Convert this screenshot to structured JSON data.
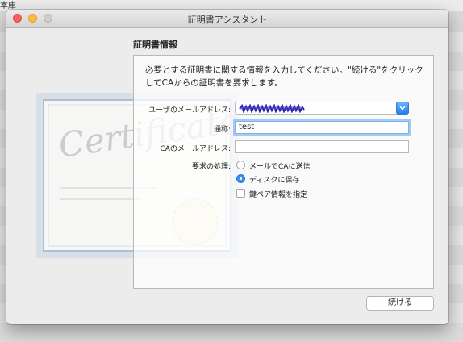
{
  "background": {
    "corner_text": "本庫"
  },
  "window": {
    "title": "証明書アシスタント",
    "section_title": "証明書情報",
    "description": "必要とする証明書に関する情報を入力してください。\"続ける\"をクリックしてCAからの証明書を要求します。"
  },
  "certificate_art": {
    "script_text": "Certificate"
  },
  "form": {
    "user_email_label": "ユーザのメールアドレス:",
    "common_name_label": "通称:",
    "common_name_value": "test",
    "ca_email_label": "CAのメールアドレス:",
    "ca_email_value": "",
    "request_label": "要求の処理:",
    "options": {
      "email_ca": {
        "label": "メールでCAに送信",
        "selected": false
      },
      "save_disk": {
        "label": "ディスクに保存",
        "selected": true
      },
      "keypair": {
        "label": "鍵ペア情報を指定",
        "checked": false
      }
    }
  },
  "buttons": {
    "continue": "続ける"
  },
  "colors": {
    "accent": "#3b8ff3",
    "close": "#fc605c",
    "minimize": "#fdbc40"
  }
}
